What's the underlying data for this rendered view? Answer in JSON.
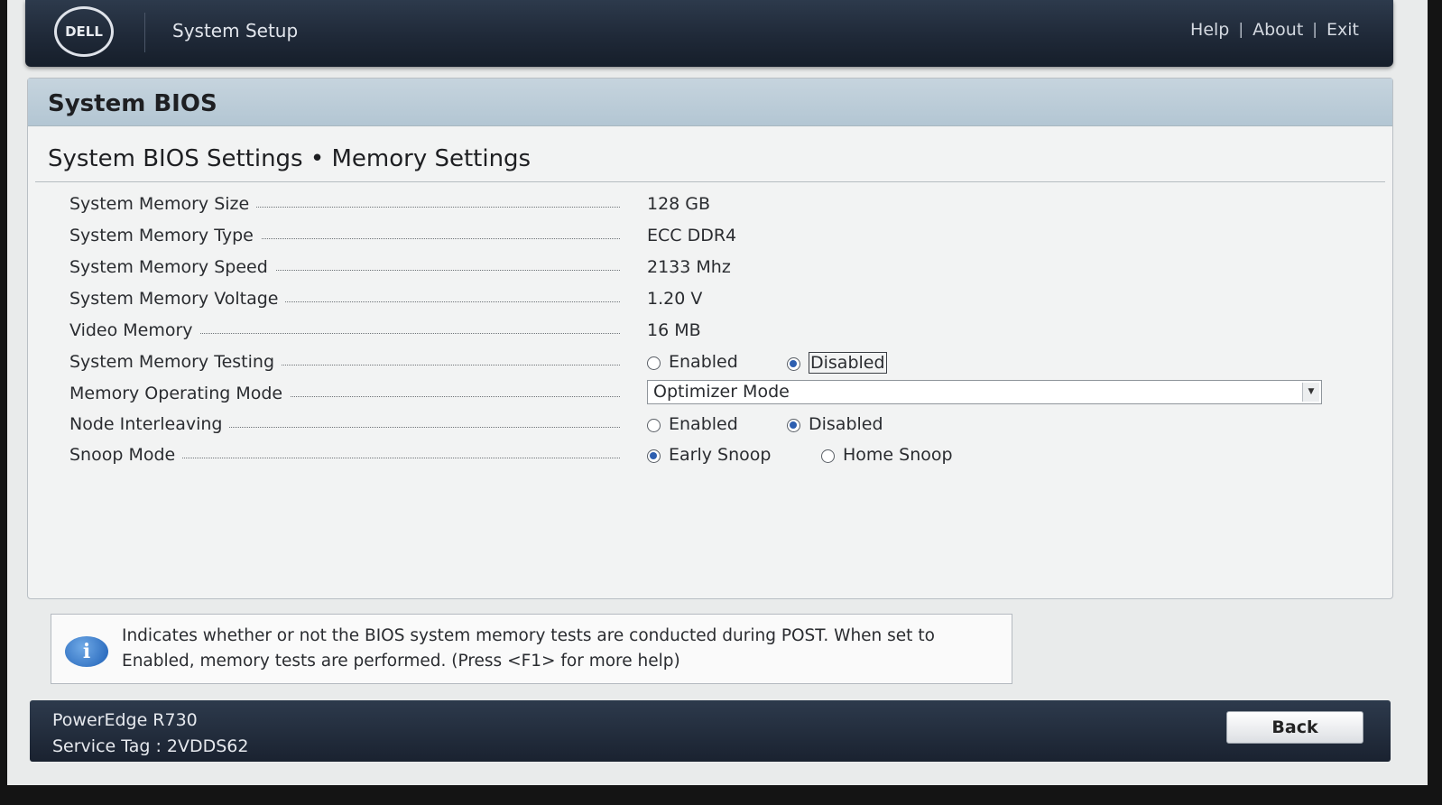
{
  "header": {
    "logo_text": "DELL",
    "app_title": "System Setup",
    "links": [
      "Help",
      "About",
      "Exit"
    ]
  },
  "panel": {
    "title": "System BIOS",
    "breadcrumb": "System BIOS Settings • Memory Settings"
  },
  "settings": {
    "memory_size": {
      "label": "System Memory Size",
      "value": "128 GB"
    },
    "memory_type": {
      "label": "System Memory Type",
      "value": "ECC DDR4"
    },
    "memory_speed": {
      "label": "System Memory Speed",
      "value": "2133 Mhz"
    },
    "memory_voltage": {
      "label": "System Memory Voltage",
      "value": "1.20 V"
    },
    "video_memory": {
      "label": "Video Memory",
      "value": "16 MB"
    },
    "memory_testing": {
      "label": "System Memory Testing",
      "options": [
        "Enabled",
        "Disabled"
      ],
      "selected": "Disabled"
    },
    "operating_mode": {
      "label": "Memory Operating Mode",
      "value": "Optimizer Mode"
    },
    "node_interleaving": {
      "label": "Node Interleaving",
      "options": [
        "Enabled",
        "Disabled"
      ],
      "selected": "Disabled"
    },
    "snoop_mode": {
      "label": "Snoop Mode",
      "options": [
        "Early Snoop",
        "Home Snoop"
      ],
      "selected": "Early Snoop"
    }
  },
  "help": {
    "icon": "info-icon",
    "line1": "Indicates whether or not the BIOS system memory tests are conducted during POST. When set to",
    "line2": "Enabled, memory tests are performed. (Press <F1> for more help)"
  },
  "footer": {
    "model": "PowerEdge R730",
    "service_tag": "Service Tag : 2VDDS62",
    "back_label": "Back"
  },
  "colors": {
    "header_bg": "#1f2938",
    "panel_header": "#b3c6d3",
    "radio_selected": "#2d5fb0"
  }
}
